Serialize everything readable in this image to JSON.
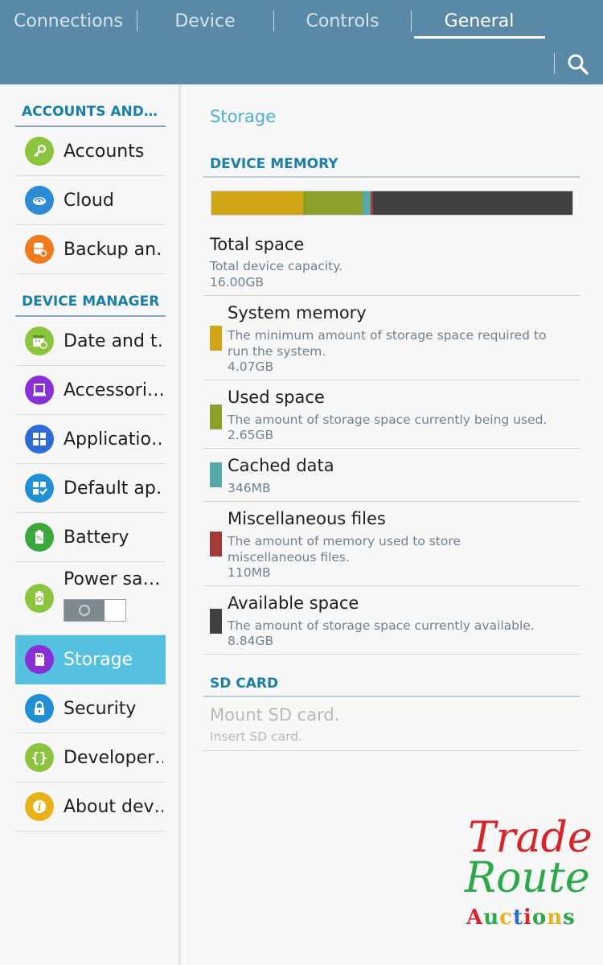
{
  "header": {
    "tabs": [
      {
        "label": "Connections"
      },
      {
        "label": "Device"
      },
      {
        "label": "Controls"
      },
      {
        "label": "General",
        "active": true
      }
    ],
    "accent_color": "#5a89a8"
  },
  "sidebar": {
    "sections": [
      {
        "title": "ACCOUNTS AND…",
        "items": [
          {
            "label": "Accounts",
            "icon": "key-icon",
            "color": "#8cc43d"
          },
          {
            "label": "Cloud",
            "icon": "cloud-icon",
            "color": "#2d8bd6"
          },
          {
            "label": "Backup an…",
            "icon": "backup-icon",
            "color": "#f07a1e"
          }
        ]
      },
      {
        "title": "DEVICE MANAGER",
        "items": [
          {
            "label": "Date and t…",
            "icon": "calendar-icon",
            "color": "#8cc43d"
          },
          {
            "label": "Accessori…",
            "icon": "accessory-icon",
            "color": "#8a2fd6"
          },
          {
            "label": "Applicatio…",
            "icon": "apps-grid-icon",
            "color": "#2d6cd6"
          },
          {
            "label": "Default ap…",
            "icon": "default-apps-icon",
            "color": "#1f8fd6"
          },
          {
            "label": "Battery",
            "icon": "battery-icon",
            "color": "#3aa83a"
          },
          {
            "label": "Power sa…",
            "icon": "power-saving-icon",
            "color": "#8cc43d",
            "toggle": "off"
          },
          {
            "label": "Storage",
            "icon": "sd-card-icon",
            "color": "#8a2fd6",
            "active": true
          },
          {
            "label": "Security",
            "icon": "lock-icon",
            "color": "#1f8fd6"
          },
          {
            "label": "Developer…",
            "icon": "braces-icon",
            "color": "#8cc43d"
          },
          {
            "label": "About dev…",
            "icon": "info-icon",
            "color": "#e8b21a"
          }
        ]
      }
    ]
  },
  "main": {
    "title": "Storage",
    "device_memory": {
      "heading": "DEVICE MEMORY",
      "bar": [
        {
          "key": "system",
          "color": "#cfa415",
          "value_gb": 4.07
        },
        {
          "key": "used",
          "color": "#8e9e2a",
          "value_gb": 2.65
        },
        {
          "key": "cached",
          "color": "#55a7a8",
          "value_gb": 0.346
        },
        {
          "key": "misc",
          "color": "#a33a3a",
          "value_gb": 0.11
        },
        {
          "key": "available",
          "color": "#404040",
          "value_gb": 8.84
        }
      ],
      "total": {
        "title": "Total space",
        "desc": "Total device capacity.",
        "value": "16.00GB"
      },
      "rows": [
        {
          "title": "System memory",
          "desc": "The minimum amount of storage space required to run the system.",
          "value": "4.07GB",
          "color": "#cfa415"
        },
        {
          "title": "Used space",
          "desc": "The amount of storage space currently being used.",
          "value": "2.65GB",
          "color": "#8e9e2a"
        },
        {
          "title": "Cached data",
          "desc": "",
          "value": "346MB",
          "color": "#55a7a8"
        },
        {
          "title": "Miscellaneous files",
          "desc": "The amount of memory used to store miscellaneous files.",
          "value": "110MB",
          "color": "#a33a3a"
        },
        {
          "title": "Available space",
          "desc": "The amount of storage space currently available.",
          "value": "8.84GB",
          "color": "#404040"
        }
      ]
    },
    "sd_card": {
      "heading": "SD CARD",
      "mount": {
        "title": "Mount SD card.",
        "desc": "Insert SD card."
      }
    }
  },
  "watermark": {
    "line1": "Trade",
    "line2": "Route",
    "line3_letters": [
      {
        "ch": "A",
        "color": "#d8232a"
      },
      {
        "ch": "u",
        "color": "#2aa84a"
      },
      {
        "ch": "c",
        "color": "#e8b21a"
      },
      {
        "ch": "t",
        "color": "#2d6cd6"
      },
      {
        "ch": "i",
        "color": "#d8232a"
      },
      {
        "ch": "o",
        "color": "#2aa84a"
      },
      {
        "ch": "n",
        "color": "#e8b21a"
      },
      {
        "ch": "s",
        "color": "#2aa84a"
      }
    ]
  }
}
